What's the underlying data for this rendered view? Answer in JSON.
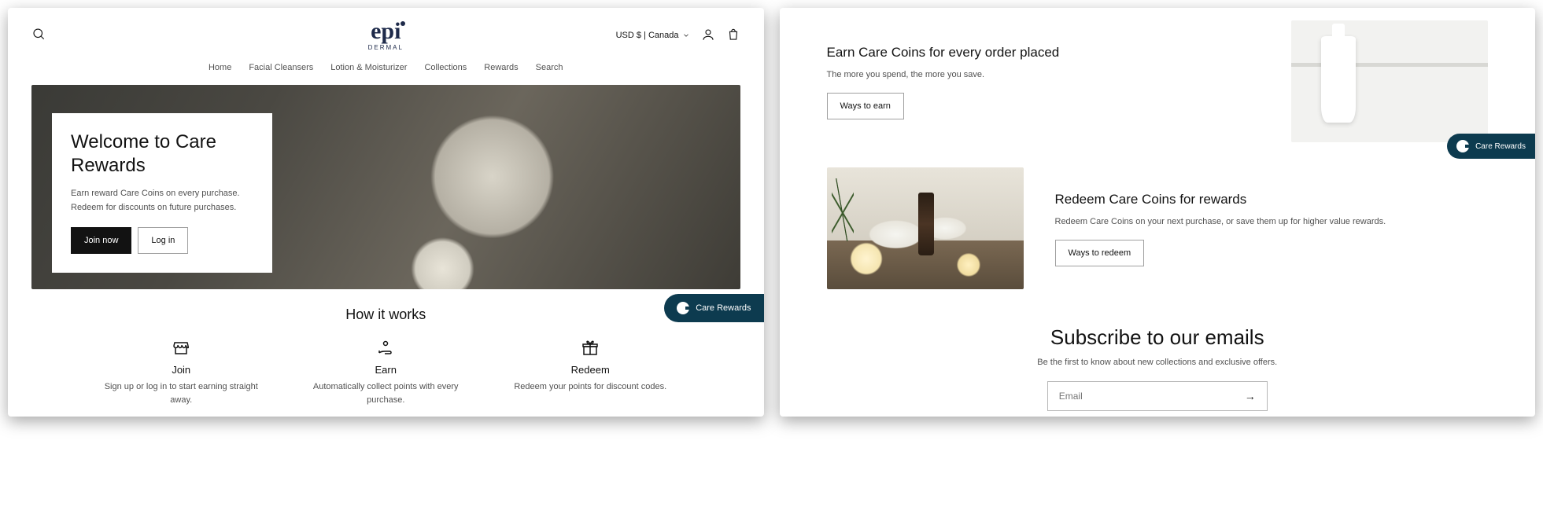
{
  "header": {
    "currency_label": "USD $ | Canada",
    "logo_main": "epi",
    "logo_sub": "DERMAL"
  },
  "nav": {
    "items": [
      "Home",
      "Facial Cleansers",
      "Lotion & Moisturizer",
      "Collections",
      "Rewards",
      "Search"
    ]
  },
  "hero": {
    "title": "Welcome to Care Rewards",
    "body": "Earn reward Care Coins on every purchase. Redeem for discounts on future purchases.",
    "join_label": "Join now",
    "login_label": "Log in"
  },
  "how": {
    "title": "How it works",
    "items": [
      {
        "title": "Join",
        "body": "Sign up or log in to start earning straight away."
      },
      {
        "title": "Earn",
        "body": "Automatically collect points with every purchase."
      },
      {
        "title": "Redeem",
        "body": "Redeem your points for discount codes."
      }
    ]
  },
  "floating_label": "Care Rewards",
  "earn": {
    "title": "Earn Care Coins for every order placed",
    "body": "The more you spend, the more you save.",
    "cta": "Ways to earn"
  },
  "redeem": {
    "title": "Redeem Care Coins for rewards",
    "body": "Redeem Care Coins on your next purchase, or save them up for higher value rewards.",
    "cta": "Ways to redeem"
  },
  "subscribe": {
    "title": "Subscribe to our emails",
    "body": "Be the first to know about new collections and exclusive offers.",
    "placeholder": "Email"
  }
}
